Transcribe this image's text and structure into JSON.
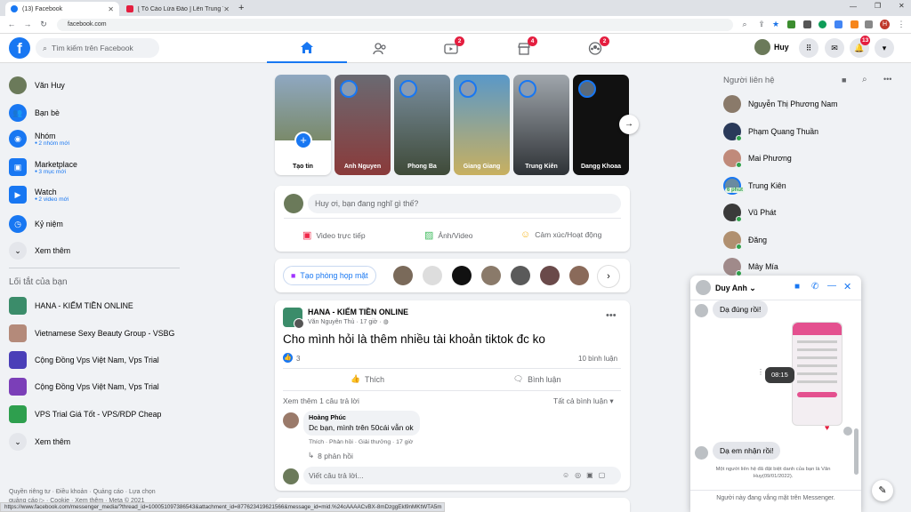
{
  "browser": {
    "tabs": [
      {
        "title": "(13) Facebook",
        "active": true
      },
      {
        "title": "[ Tố Cáo Lừa Đảo ] Lên Trung Tâm",
        "active": false
      }
    ],
    "new_tab": "+",
    "url": "facebook.com",
    "status_url": "https://www.facebook.com/messenger_media/?thread_id=100051097386543&attachment_id=877623419621566&message_id=mid.%24cAAAACvBX-8mDzggEkl9nMKtWTA5m"
  },
  "header": {
    "search_placeholder": "Tìm kiếm trên Facebook",
    "nav_badges": {
      "watch": "2",
      "marketplace": "4",
      "groups": "2"
    },
    "profile_name": "Huy",
    "notif_badge": "13"
  },
  "left_sidebar": {
    "profile": "Văn Huy",
    "items": [
      {
        "label": "Bạn bè",
        "sub": ""
      },
      {
        "label": "Nhóm",
        "sub": "2 nhóm mới"
      },
      {
        "label": "Marketplace",
        "sub": "3 mục mới"
      },
      {
        "label": "Watch",
        "sub": "2 video mới"
      },
      {
        "label": "Kỷ niệm",
        "sub": ""
      },
      {
        "label": "Xem thêm",
        "sub": ""
      }
    ],
    "shortcuts_title": "Lối tắt của bạn",
    "shortcuts": [
      "HANA - KIẾM TIỀN ONLINE",
      "Vietnamese Sexy Beauty Group - VSBG",
      "Cộng Đồng Vps Việt Nam, Vps Trial",
      "Cộng Đồng Vps Việt Nam, Vps Trial",
      "VPS Trial Giá Tốt - VPS/RDP Cheap"
    ],
    "shortcuts_more": "Xem thêm",
    "footer": "Quyền riêng tư · Điều khoản · Quảng cáo · Lựa chọn quảng cáo ▷ · Cookie · Xem thêm · Meta © 2021"
  },
  "stories": {
    "create_label": "Tạo tin",
    "items": [
      "Anh Nguyen",
      "Phong Ba",
      "Giang Giang",
      "Trung Kiên",
      "Dangg Khoaa"
    ],
    "next": "→"
  },
  "composer": {
    "placeholder": "Huy ơi, bạn đang nghĩ gì thế?",
    "actions": [
      "Video trực tiếp",
      "Ảnh/Video",
      "Cảm xúc/Hoạt động"
    ]
  },
  "rooms": {
    "create_label": "Tạo phòng họp mặt"
  },
  "post": {
    "group": "HANA - KIẾM TIỀN ONLINE",
    "author_line": "Văn Nguyên Thủ · 17 giờ · ",
    "text": "Cho mình hỏi là thêm nhiều tài khoản tiktok đc ko",
    "reaction_count": "3",
    "comment_count": "10 bình luận",
    "like_label": "Thích",
    "comment_label": "Bình luận",
    "more_replies": "Xem thêm 1 câu trả lời",
    "filter": "Tất cả bình luận",
    "comment": {
      "author": "Hoàng Phúc",
      "text": "Dc bạn, mình trên 50cái vẫn ok",
      "actions": "Thích · Phản hồi · Giải thưởng · 17 giờ",
      "replies": "8 phản hồi"
    },
    "reply_placeholder": "Viết câu trả lời..."
  },
  "contacts": {
    "title": "Người liên hệ",
    "items": [
      {
        "name": "Nguyễn Thị Phương Nam",
        "online": false
      },
      {
        "name": "Phạm Quang Thuần",
        "online": true
      },
      {
        "name": "Mai Phương",
        "online": true
      },
      {
        "name": "Trung Kiên",
        "online": false,
        "ago": "6 phút"
      },
      {
        "name": "Vũ Phát",
        "online": true
      },
      {
        "name": "Đăng",
        "online": true
      },
      {
        "name": "Mây Mía",
        "online": true
      }
    ]
  },
  "chat": {
    "name": "Duy Anh",
    "msg1": "Dạ đúng rồi!",
    "time_tooltip": "08:15",
    "msg2": "Dạ em nhận rồi!",
    "notice": "Một người liên hệ đã đặt biệt danh của bạn là Văn Huy(09/01/2022).",
    "offline": "Người này đang vắng mặt trên Messenger."
  },
  "colors": {
    "brand": "#1877f2",
    "badge": "#e41e3f",
    "online": "#31a24c"
  }
}
